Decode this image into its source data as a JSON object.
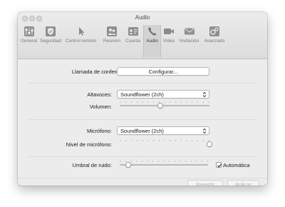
{
  "window": {
    "title": "Audio"
  },
  "toolbar": {
    "tabs": [
      {
        "label": "General",
        "icon": "sliders-icon"
      },
      {
        "label": "Seguridad",
        "icon": "shield-icon"
      },
      {
        "label": "Control remoto",
        "icon": "cursor-icon"
      },
      {
        "label": "Reunión",
        "icon": "meeting-icon"
      },
      {
        "label": "Cuenta",
        "icon": "account-icon"
      },
      {
        "label": "Audio",
        "icon": "phone-icon",
        "active": true
      },
      {
        "label": "Video",
        "icon": "video-icon"
      },
      {
        "label": "Invitación",
        "icon": "envelope-icon"
      },
      {
        "label": "Avanzado",
        "icon": "gears-icon"
      }
    ]
  },
  "conference": {
    "label": "Llamada de conferencia:",
    "button": "Configurar..."
  },
  "speakers": {
    "label": "Altavoces:",
    "device": "Soundflower (2ch)",
    "volume_label": "Volumen:",
    "volume_level": 0.45
  },
  "microphone": {
    "label": "Micrófono:",
    "device": "Soundflower (2ch)",
    "level_label": "Nivel de micrófono:",
    "level_value": 1.0
  },
  "noise": {
    "label": "Umbral de ruido:",
    "level": 0.1,
    "auto_label": "Automática",
    "auto_checked": true
  },
  "footer": {
    "revert": "Revertir",
    "apply": "Aplicar"
  },
  "colors": {
    "window_bg": "#ececec",
    "text": "#1a1a1a",
    "disabled_text": "#b0b0b0"
  }
}
